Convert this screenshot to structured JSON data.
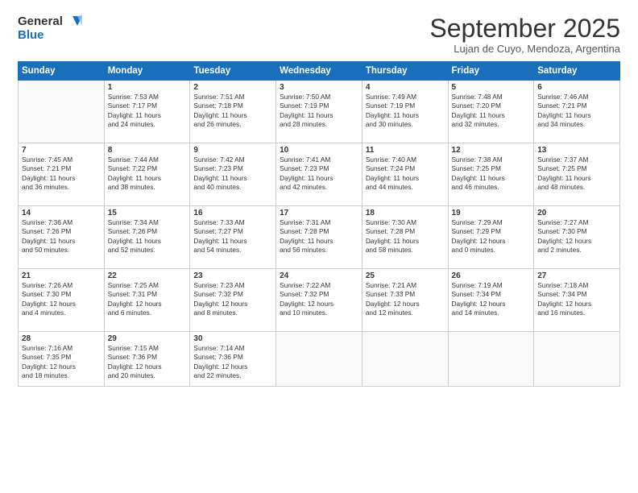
{
  "logo": {
    "line1": "General",
    "line2": "Blue"
  },
  "title": "September 2025",
  "subtitle": "Lujan de Cuyo, Mendoza, Argentina",
  "weekdays": [
    "Sunday",
    "Monday",
    "Tuesday",
    "Wednesday",
    "Thursday",
    "Friday",
    "Saturday"
  ],
  "weeks": [
    [
      {
        "day": "",
        "info": ""
      },
      {
        "day": "1",
        "info": "Sunrise: 7:53 AM\nSunset: 7:17 PM\nDaylight: 11 hours\nand 24 minutes."
      },
      {
        "day": "2",
        "info": "Sunrise: 7:51 AM\nSunset: 7:18 PM\nDaylight: 11 hours\nand 26 minutes."
      },
      {
        "day": "3",
        "info": "Sunrise: 7:50 AM\nSunset: 7:19 PM\nDaylight: 11 hours\nand 28 minutes."
      },
      {
        "day": "4",
        "info": "Sunrise: 7:49 AM\nSunset: 7:19 PM\nDaylight: 11 hours\nand 30 minutes."
      },
      {
        "day": "5",
        "info": "Sunrise: 7:48 AM\nSunset: 7:20 PM\nDaylight: 11 hours\nand 32 minutes."
      },
      {
        "day": "6",
        "info": "Sunrise: 7:46 AM\nSunset: 7:21 PM\nDaylight: 11 hours\nand 34 minutes."
      }
    ],
    [
      {
        "day": "7",
        "info": "Sunrise: 7:45 AM\nSunset: 7:21 PM\nDaylight: 11 hours\nand 36 minutes."
      },
      {
        "day": "8",
        "info": "Sunrise: 7:44 AM\nSunset: 7:22 PM\nDaylight: 11 hours\nand 38 minutes."
      },
      {
        "day": "9",
        "info": "Sunrise: 7:42 AM\nSunset: 7:23 PM\nDaylight: 11 hours\nand 40 minutes."
      },
      {
        "day": "10",
        "info": "Sunrise: 7:41 AM\nSunset: 7:23 PM\nDaylight: 11 hours\nand 42 minutes."
      },
      {
        "day": "11",
        "info": "Sunrise: 7:40 AM\nSunset: 7:24 PM\nDaylight: 11 hours\nand 44 minutes."
      },
      {
        "day": "12",
        "info": "Sunrise: 7:38 AM\nSunset: 7:25 PM\nDaylight: 11 hours\nand 46 minutes."
      },
      {
        "day": "13",
        "info": "Sunrise: 7:37 AM\nSunset: 7:25 PM\nDaylight: 11 hours\nand 48 minutes."
      }
    ],
    [
      {
        "day": "14",
        "info": "Sunrise: 7:36 AM\nSunset: 7:26 PM\nDaylight: 11 hours\nand 50 minutes."
      },
      {
        "day": "15",
        "info": "Sunrise: 7:34 AM\nSunset: 7:26 PM\nDaylight: 11 hours\nand 52 minutes."
      },
      {
        "day": "16",
        "info": "Sunrise: 7:33 AM\nSunset: 7:27 PM\nDaylight: 11 hours\nand 54 minutes."
      },
      {
        "day": "17",
        "info": "Sunrise: 7:31 AM\nSunset: 7:28 PM\nDaylight: 11 hours\nand 56 minutes."
      },
      {
        "day": "18",
        "info": "Sunrise: 7:30 AM\nSunset: 7:28 PM\nDaylight: 11 hours\nand 58 minutes."
      },
      {
        "day": "19",
        "info": "Sunrise: 7:29 AM\nSunset: 7:29 PM\nDaylight: 12 hours\nand 0 minutes."
      },
      {
        "day": "20",
        "info": "Sunrise: 7:27 AM\nSunset: 7:30 PM\nDaylight: 12 hours\nand 2 minutes."
      }
    ],
    [
      {
        "day": "21",
        "info": "Sunrise: 7:26 AM\nSunset: 7:30 PM\nDaylight: 12 hours\nand 4 minutes."
      },
      {
        "day": "22",
        "info": "Sunrise: 7:25 AM\nSunset: 7:31 PM\nDaylight: 12 hours\nand 6 minutes."
      },
      {
        "day": "23",
        "info": "Sunrise: 7:23 AM\nSunset: 7:32 PM\nDaylight: 12 hours\nand 8 minutes."
      },
      {
        "day": "24",
        "info": "Sunrise: 7:22 AM\nSunset: 7:32 PM\nDaylight: 12 hours\nand 10 minutes."
      },
      {
        "day": "25",
        "info": "Sunrise: 7:21 AM\nSunset: 7:33 PM\nDaylight: 12 hours\nand 12 minutes."
      },
      {
        "day": "26",
        "info": "Sunrise: 7:19 AM\nSunset: 7:34 PM\nDaylight: 12 hours\nand 14 minutes."
      },
      {
        "day": "27",
        "info": "Sunrise: 7:18 AM\nSunset: 7:34 PM\nDaylight: 12 hours\nand 16 minutes."
      }
    ],
    [
      {
        "day": "28",
        "info": "Sunrise: 7:16 AM\nSunset: 7:35 PM\nDaylight: 12 hours\nand 18 minutes."
      },
      {
        "day": "29",
        "info": "Sunrise: 7:15 AM\nSunset: 7:36 PM\nDaylight: 12 hours\nand 20 minutes."
      },
      {
        "day": "30",
        "info": "Sunrise: 7:14 AM\nSunset: 7:36 PM\nDaylight: 12 hours\nand 22 minutes."
      },
      {
        "day": "",
        "info": ""
      },
      {
        "day": "",
        "info": ""
      },
      {
        "day": "",
        "info": ""
      },
      {
        "day": "",
        "info": ""
      }
    ]
  ]
}
